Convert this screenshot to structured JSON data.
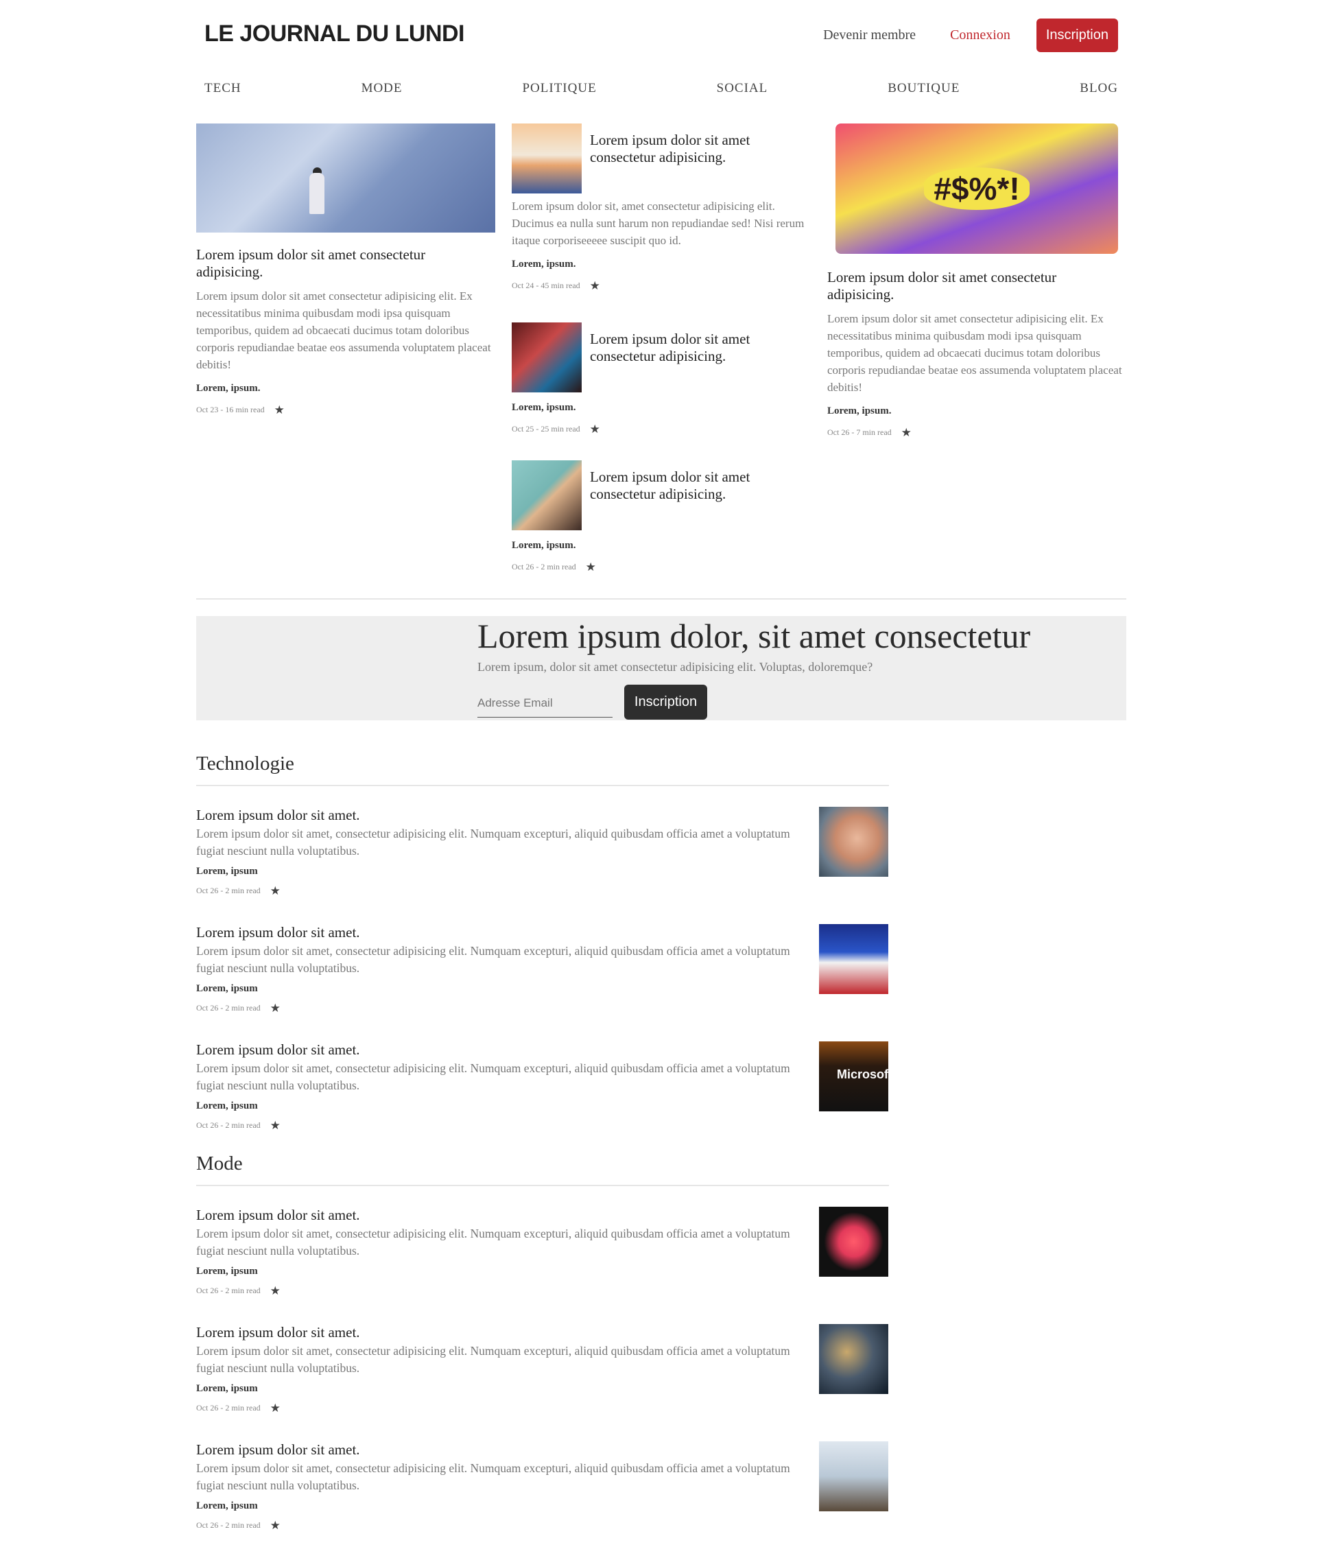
{
  "header": {
    "logo": "LE JOURNAL DU LUNDI",
    "member_link": "Devenir membre",
    "login_link": "Connexion",
    "signup_button": "Inscription"
  },
  "nav": [
    "TECH",
    "MODE",
    "POLITIQUE",
    "SOCIAL",
    "BOUTIQUE",
    "BLOG"
  ],
  "featured": {
    "left": {
      "title": "Lorem ipsum dolor sit amet consectetur adipisicing.",
      "excerpt": "Lorem ipsum dolor sit amet consectetur adipisicing elit. Ex necessitatibus minima quibusdam modi ipsa quisquam temporibus, quidem ad obcaecati ducimus totam doloribus corporis repudiandae beatae eos assumenda voluptatem placeat debitis!",
      "author": "Lorem, ipsum.",
      "meta": "Oct 23 - 16 min read"
    },
    "middle": [
      {
        "title": "Lorem ipsum dolor sit amet consectetur adipisicing.",
        "excerpt": "Lorem ipsum dolor sit, amet consectetur adipisicing elit. Ducimus ea nulla sunt harum non repudiandae sed! Nisi rerum itaque corporiseeeee suscipit quo id.",
        "author": "Lorem, ipsum.",
        "meta": "Oct 24 - 45 min read"
      },
      {
        "title": "Lorem ipsum dolor sit amet consectetur adipisicing.",
        "author": "Lorem, ipsum.",
        "meta": "Oct 25 - 25 min read"
      },
      {
        "title": "Lorem ipsum dolor sit amet consectetur adipisicing.",
        "author": "Lorem, ipsum.",
        "meta": "Oct 26 - 2 min read"
      }
    ],
    "right": {
      "image_text": "#$%*!",
      "title": "Lorem ipsum dolor sit amet consectetur adipisicing.",
      "excerpt": "Lorem ipsum dolor sit amet consectetur adipisicing elit. Ex necessitatibus minima quibusdam modi ipsa quisquam temporibus, quidem ad obcaecati ducimus totam doloribus corporis repudiandae beatae eos assumenda voluptatem placeat debitis!",
      "author": "Lorem, ipsum.",
      "meta": "Oct 26 - 7 min read"
    }
  },
  "newsletter": {
    "title": "Lorem ipsum dolor, sit amet consectetur",
    "subtitle": "Lorem ipsum, dolor sit amet consectetur adipisicing elit. Voluptas, doloremque?",
    "email_placeholder": "Adresse Email",
    "button": "Inscription"
  },
  "sections": [
    {
      "title": "Technologie",
      "articles": [
        {
          "title": "Lorem ipsum dolor sit amet.",
          "excerpt": "Lorem ipsum dolor sit amet, consectetur adipisicing elit. Numquam excepturi, aliquid quibusdam officia amet a voluptatum fugiat nesciunt nulla voluptatibus.",
          "author": "Lorem, ipsum",
          "meta": "Oct 26 - 2 min read"
        },
        {
          "title": "Lorem ipsum dolor sit amet.",
          "excerpt": "Lorem ipsum dolor sit amet, consectetur adipisicing elit. Numquam excepturi, aliquid quibusdam officia amet a voluptatum fugiat nesciunt nulla voluptatibus.",
          "author": "Lorem, ipsum",
          "meta": "Oct 26 - 2 min read"
        },
        {
          "title": "Lorem ipsum dolor sit amet.",
          "excerpt": "Lorem ipsum dolor sit amet, consectetur adipisicing elit. Numquam excepturi, aliquid quibusdam officia amet a voluptatum fugiat nesciunt nulla voluptatibus.",
          "author": "Lorem, ipsum",
          "meta": "Oct 26 - 2 min read",
          "image_text": "Microsof"
        }
      ]
    },
    {
      "title": "Mode",
      "articles": [
        {
          "title": "Lorem ipsum dolor sit amet.",
          "excerpt": "Lorem ipsum dolor sit amet, consectetur adipisicing elit. Numquam excepturi, aliquid quibusdam officia amet a voluptatum fugiat nesciunt nulla voluptatibus.",
          "author": "Lorem, ipsum",
          "meta": "Oct 26 - 2 min read"
        },
        {
          "title": "Lorem ipsum dolor sit amet.",
          "excerpt": "Lorem ipsum dolor sit amet, consectetur adipisicing elit. Numquam excepturi, aliquid quibusdam officia amet a voluptatum fugiat nesciunt nulla voluptatibus.",
          "author": "Lorem, ipsum",
          "meta": "Oct 26 - 2 min read"
        },
        {
          "title": "Lorem ipsum dolor sit amet.",
          "excerpt": "Lorem ipsum dolor sit amet, consectetur adipisicing elit. Numquam excepturi, aliquid quibusdam officia amet a voluptatum fugiat nesciunt nulla voluptatibus.",
          "author": "Lorem, ipsum",
          "meta": "Oct 26 - 2 min read"
        }
      ]
    }
  ],
  "icons": {
    "star": "star-icon"
  },
  "colors": {
    "brand_red": "#c0272d",
    "dark_button": "#2e2e2e",
    "newsletter_bg": "#eeeeee"
  }
}
